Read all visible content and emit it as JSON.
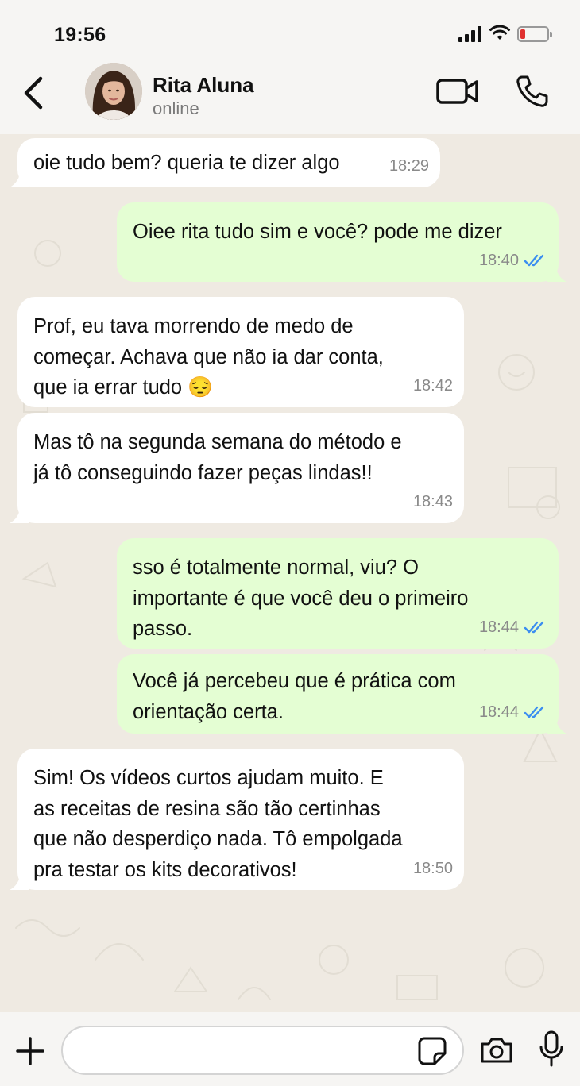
{
  "status_bar": {
    "time": "19:56"
  },
  "header": {
    "contact_name": "Rita Aluna",
    "contact_status": "online"
  },
  "messages": [
    {
      "direction": "in",
      "text": [
        "oie tudo bem? queria te dizer algo"
      ],
      "time": "18:29"
    },
    {
      "direction": "out",
      "text": [
        "Oiee rita tudo sim e você? pode me dizer"
      ],
      "time": "18:40",
      "read": true
    },
    {
      "direction": "in",
      "text": [
        "Prof, eu tava morrendo de medo de",
        "começar. Achava que não ia dar conta,",
        "que ia errar tudo 😔"
      ],
      "time": "18:42"
    },
    {
      "direction": "in",
      "text": [
        "Mas tô na segunda semana do método e",
        "já tô conseguindo fazer peças lindas!!"
      ],
      "time": "18:43"
    },
    {
      "direction": "out",
      "text": [
        "sso é totalmente normal, viu? O",
        "importante é que você deu o primeiro",
        "passo."
      ],
      "time": "18:44",
      "read": true
    },
    {
      "direction": "out",
      "text": [
        "Você já percebeu que é prática com",
        "orientação certa."
      ],
      "time": "18:44",
      "read": true
    },
    {
      "direction": "in",
      "text": [
        "Sim! Os vídeos curtos ajudam muito. E",
        "as receitas de resina são tão certinhas",
        "que não desperdiço nada. Tô empolgada",
        "pra testar os kits decorativos!"
      ],
      "time": "18:50"
    }
  ],
  "composer": {
    "placeholder": ""
  },
  "colors": {
    "incoming_bubble": "#ffffff",
    "outgoing_bubble": "#e4fed3",
    "read_ticks": "#3b8ef0",
    "chat_background": "#efeae2"
  }
}
